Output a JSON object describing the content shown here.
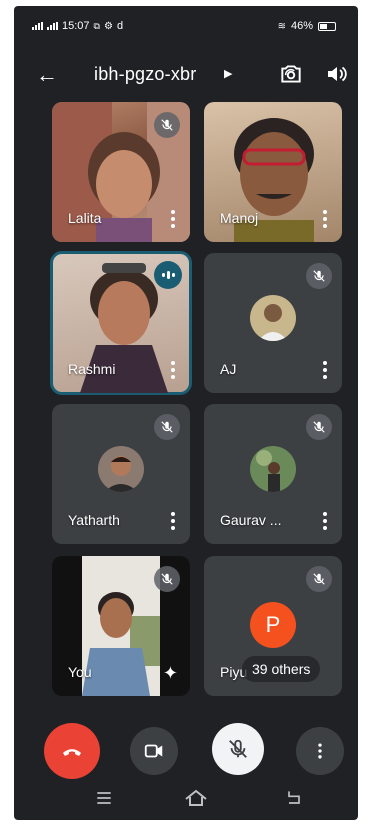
{
  "status": {
    "time": "15:07",
    "icons_left": [
      "signal-icon",
      "signal-icon",
      "cast-icon",
      "vpn-icon",
      "d-icon"
    ],
    "battery": "46%"
  },
  "header": {
    "meeting_code": "ibh-pgzo-xbr"
  },
  "participants": [
    {
      "name": "Lalita",
      "muted": true
    },
    {
      "name": "Manoj",
      "muted": false
    },
    {
      "name": "Rashmi",
      "muted": false,
      "speaking": true
    },
    {
      "name": "AJ",
      "muted": true
    },
    {
      "name": "Yatharth",
      "muted": true
    },
    {
      "name": "Gaurav ...",
      "muted": true
    },
    {
      "name": "You",
      "muted": true
    },
    {
      "name": "Piyu",
      "muted": true,
      "avatar_letter": "P",
      "overflow_label": "39 others"
    }
  ],
  "colors": {
    "end_call": "#ea4335",
    "active_border": "#1a5d73",
    "avatar_p": "#f4511e",
    "background": "#202124",
    "tile": "#3c4043"
  }
}
